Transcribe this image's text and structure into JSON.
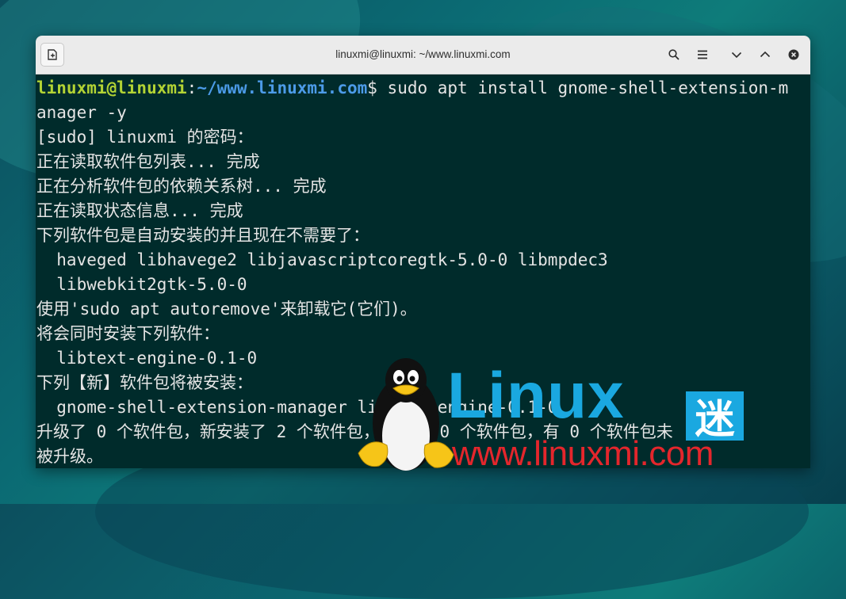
{
  "window": {
    "title": "linuxmi@linuxmi: ~/www.linuxmi.com",
    "buttons": [
      "new-tab-icon",
      "search-icon",
      "hamburger-menu-icon",
      "minimize-icon",
      "maximize-icon",
      "close-icon"
    ]
  },
  "terminal": {
    "prompt_user": "linuxmi@linuxmi",
    "prompt_sep": ":",
    "prompt_path": "~/www.linuxmi.com",
    "prompt_symbol": "$",
    "command_1": " sudo apt install gnome-shell-extension-m",
    "command_2": "anager -y",
    "lines": [
      "[sudo] linuxmi 的密码：",
      "正在读取软件包列表... 完成",
      "正在分析软件包的依赖关系树... 完成",
      "正在读取状态信息... 完成",
      "下列软件包是自动安装的并且现在不需要了：",
      "  haveged libhavege2 libjavascriptcoregtk-5.0-0 libmpdec3",
      "  libwebkit2gtk-5.0-0",
      "使用'sudo apt autoremove'来卸载它(它们)。",
      "将会同时安装下列软件：",
      "  libtext-engine-0.1-0",
      "下列【新】软件包将被安装：",
      "  gnome-shell-extension-manager libtext-engine-0.1-0",
      "升级了 0 个软件包，新安装了 2 个软件包，要卸载 0 个软件包，有 0 个软件包未",
      "被升级。"
    ]
  },
  "watermark": {
    "brand_word": "Linux",
    "brand_char": "迷",
    "url": "www.linuxmi.com"
  },
  "colors": {
    "terminal_bg": "#002b2b",
    "prompt_user": "#b3d334",
    "prompt_path": "#4c9be8",
    "watermark_blue": "#1aa8e0",
    "watermark_red": "#e4262c"
  }
}
